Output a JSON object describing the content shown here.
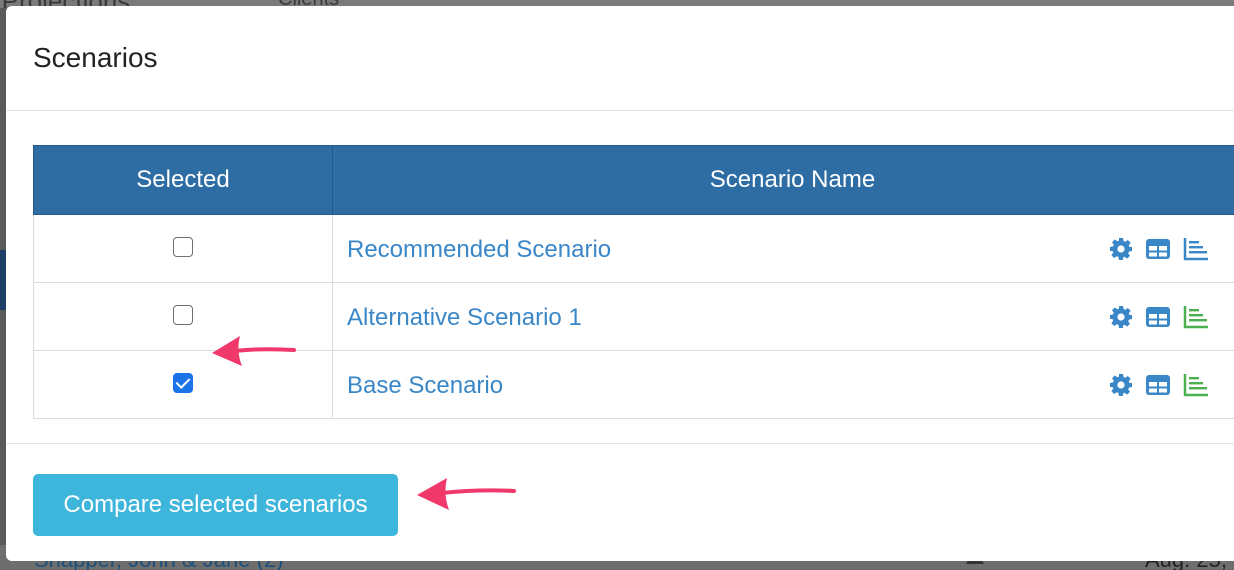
{
  "background": {
    "header_fragment": "...Projections",
    "nav_fragment": "Clients",
    "client_fragment": "Snapper, John & Jane (2)",
    "date_fragment": "Aug. 25,"
  },
  "modal": {
    "title": "Scenarios",
    "table": {
      "columns": [
        "Selected",
        "Scenario Name"
      ],
      "rows": [
        {
          "name": "Recommended Scenario",
          "selected": false,
          "chart_icon_color": "#3a87c8"
        },
        {
          "name": "Alternative Scenario 1",
          "selected": false,
          "chart_icon_color": "#4caf50"
        },
        {
          "name": "Base Scenario",
          "selected": true,
          "chart_icon_color": "#4caf50"
        }
      ],
      "row_icons": [
        "gear-icon",
        "table-icon",
        "bar-chart-icon"
      ]
    },
    "footer": {
      "compare_label": "Compare selected scenarios"
    }
  },
  "colors": {
    "header_bg": "#2e6da4",
    "link": "#3a87c8",
    "button": "#3eb6dc",
    "annotation_arrow": "#f0386b"
  }
}
